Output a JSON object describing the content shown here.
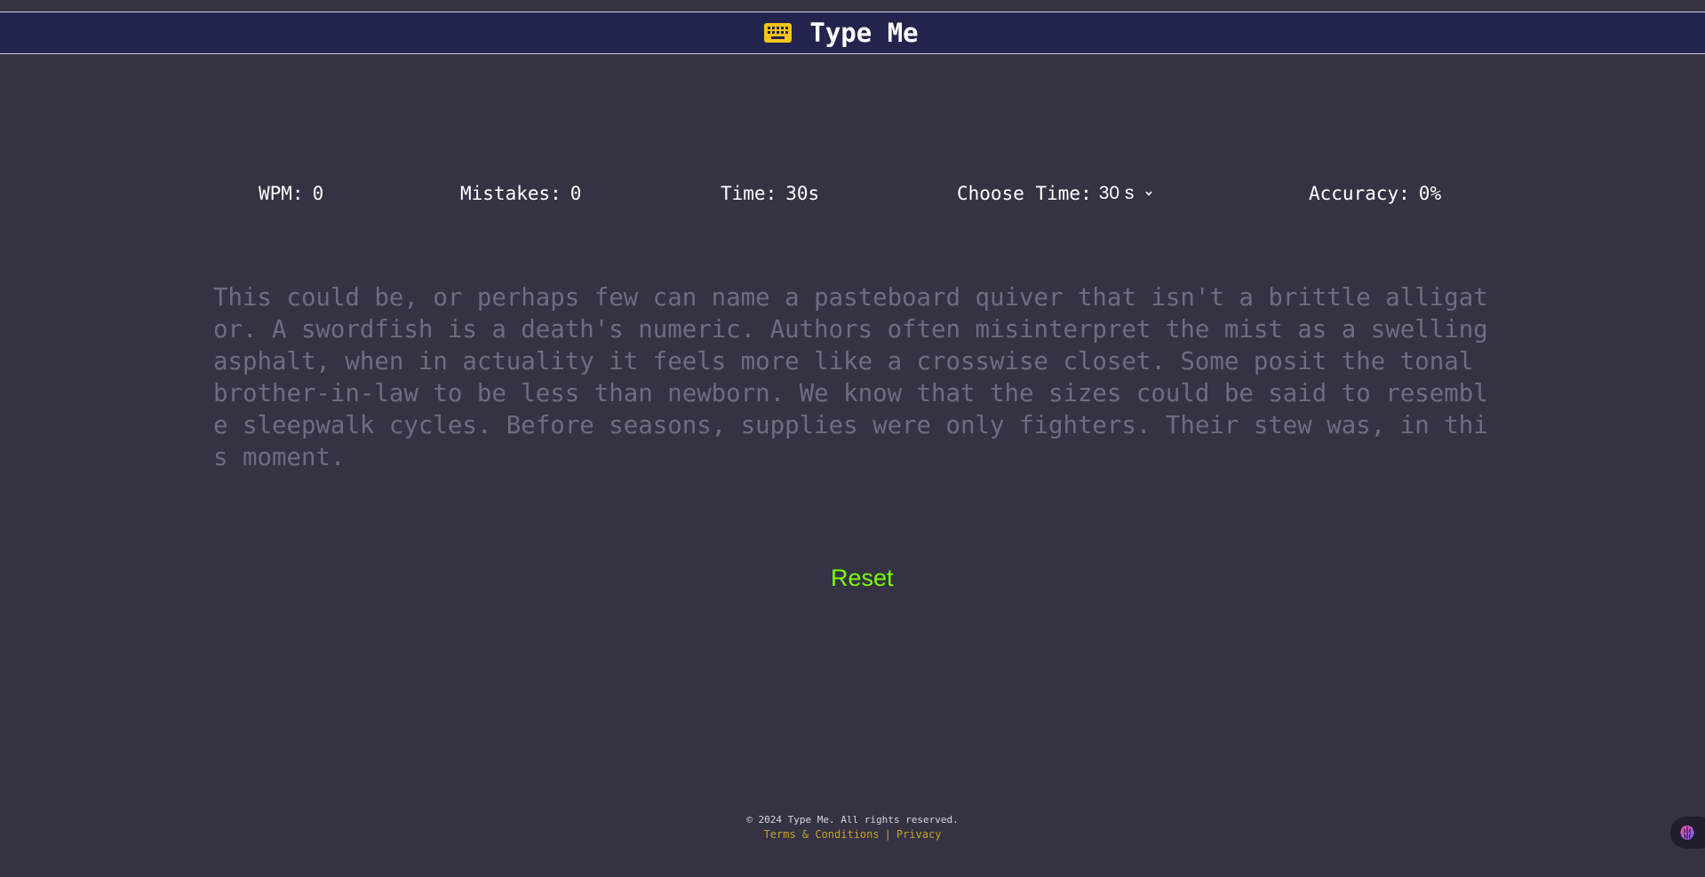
{
  "header": {
    "title": "Type Me",
    "icon": "keyboard-icon"
  },
  "stats": {
    "wpm_label": "WPM:",
    "wpm_value": "0",
    "mistakes_label": "Mistakes:",
    "mistakes_value": "0",
    "time_label": "Time:",
    "time_value": "30s",
    "choose_time_label": "Choose Time:",
    "choose_time_selected": "30 s",
    "accuracy_label": "Accuracy:",
    "accuracy_value": "0%"
  },
  "passage": {
    "text": "This could be, or perhaps few can name a pasteboard quiver that isn't a brittle alligator. A swordfish is a death's numeric. Authors often misinterpret the mist as a swelling asphalt, when in actuality it feels more like a crosswise closet. Some posit the tonal brother-in-law to be less than newborn. We know that the sizes could be said to resemble sleepwalk cycles. Before seasons, supplies were only fighters. Their stew was, in this moment."
  },
  "actions": {
    "reset_label": "Reset"
  },
  "footer": {
    "copyright": "© 2024 Type Me. All rights reserved.",
    "terms_label": "Terms & Conditions",
    "separator": "|",
    "privacy_label": "Privacy"
  },
  "colors": {
    "background": "#343243",
    "header_bg": "#23244e",
    "passage_text": "#6e6d7f",
    "reset_accent": "#7cfc00",
    "footer_link": "#c9a227",
    "keyboard_icon": "#f5c518"
  },
  "floating_button": {
    "icon": "brain-icon"
  }
}
